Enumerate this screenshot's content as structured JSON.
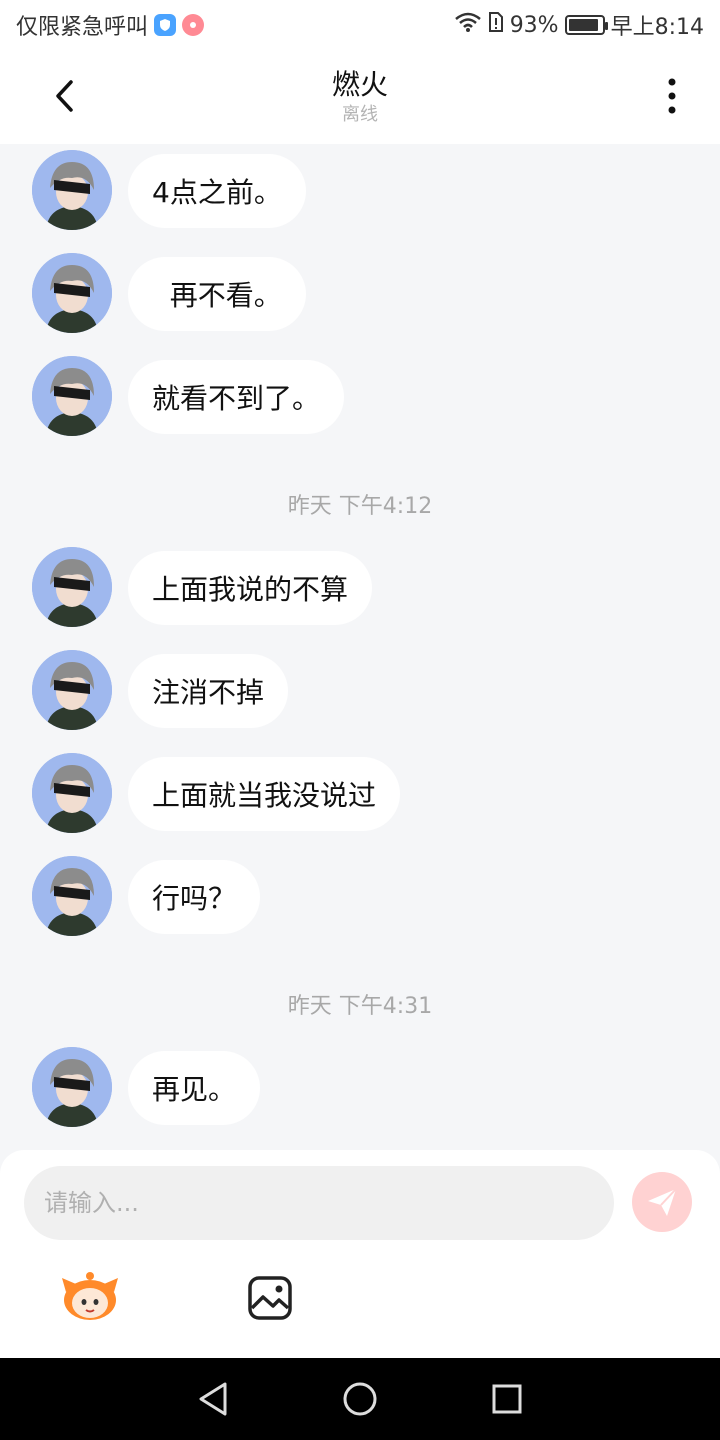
{
  "status_bar": {
    "carrier_text": "仅限紧急呼叫",
    "battery_percent": "93%",
    "battery_level": 0.93,
    "time": "早上8:14"
  },
  "header": {
    "title": "燃火",
    "subtitle": "离线"
  },
  "messages": [
    {
      "type": "msg",
      "text": "4点之前。"
    },
    {
      "type": "msg",
      "text": "  再不看。"
    },
    {
      "type": "msg",
      "text": "就看不到了。"
    },
    {
      "type": "time",
      "text": "昨天 下午4:12"
    },
    {
      "type": "msg",
      "text": "上面我说的不算"
    },
    {
      "type": "msg",
      "text": "注消不掉"
    },
    {
      "type": "msg",
      "text": "上面就当我没说过"
    },
    {
      "type": "msg",
      "text": "行吗？"
    },
    {
      "type": "time",
      "text": "昨天 下午4:31"
    },
    {
      "type": "msg",
      "text": "再见。"
    }
  ],
  "input": {
    "placeholder": "请输入...",
    "value": ""
  },
  "colors": {
    "background": "#f5f6f8",
    "bubble": "#ffffff",
    "send_button": "#ffd2d2",
    "avatar_bg": "#9fb8ee"
  }
}
